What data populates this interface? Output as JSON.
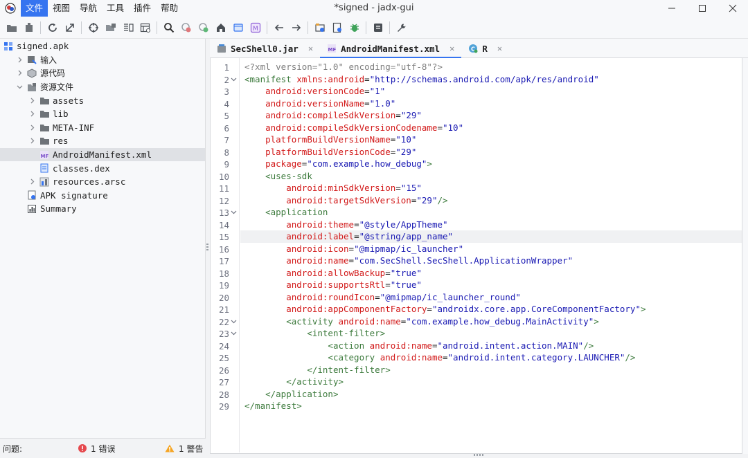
{
  "window": {
    "title": "*signed - jadx-gui",
    "menu": [
      "文件",
      "视图",
      "导航",
      "工具",
      "插件",
      "帮助"
    ]
  },
  "toolbar": {
    "icons": [
      "open-folder-icon",
      "export-icon",
      "refresh-icon",
      "goto-icon",
      "sync-icon",
      "flatten-icon",
      "text-search-icon",
      "class-search-icon",
      "search-icon",
      "find-usage-icon",
      "find-usage-alt-icon",
      "home-icon",
      "window-icon",
      "mapping-icon",
      "back-icon",
      "forward-icon",
      "deobf-icon",
      "log-icon",
      "debug-icon",
      "preferences-file-icon",
      "settings-icon"
    ]
  },
  "tree": {
    "root": "signed.apk",
    "items": [
      {
        "label": "signed.apk",
        "icon": "apk-icon",
        "level": 0,
        "arrow": ""
      },
      {
        "label": "输入",
        "icon": "input-icon",
        "level": 1,
        "arrow": ">"
      },
      {
        "label": "源代码",
        "icon": "package-icon",
        "level": 1,
        "arrow": ">"
      },
      {
        "label": "资源文件",
        "icon": "resources-icon",
        "level": 1,
        "arrow": "v"
      },
      {
        "label": "assets",
        "icon": "folder-icon",
        "level": 2,
        "arrow": ">"
      },
      {
        "label": "lib",
        "icon": "folder-icon",
        "level": 2,
        "arrow": ">"
      },
      {
        "label": "META-INF",
        "icon": "folder-icon",
        "level": 2,
        "arrow": ">"
      },
      {
        "label": "res",
        "icon": "folder-icon",
        "level": 2,
        "arrow": ">"
      },
      {
        "label": "AndroidManifest.xml",
        "icon": "manifest-icon",
        "level": 2,
        "arrow": ""
      },
      {
        "label": "classes.dex",
        "icon": "dex-icon",
        "level": 2,
        "arrow": ""
      },
      {
        "label": "resources.arsc",
        "icon": "arsc-icon",
        "level": 2,
        "arrow": ">"
      },
      {
        "label": "APK signature",
        "icon": "signature-icon",
        "level": 1,
        "arrow": ""
      },
      {
        "label": "Summary",
        "icon": "summary-icon",
        "level": 1,
        "arrow": ""
      }
    ],
    "selected_index": 8
  },
  "status": {
    "label": "问题:",
    "errors": "1 错误",
    "warnings": "1 警告"
  },
  "tabs": [
    {
      "label": "SecShell0.jar",
      "icon": "jar-icon",
      "active": false
    },
    {
      "label": "AndroidManifest.xml",
      "icon": "manifest-icon",
      "active": true
    },
    {
      "label": "R",
      "icon": "class-icon",
      "active": false
    }
  ],
  "editor": {
    "highlight_line": 15,
    "fold_lines": [
      2,
      13,
      22,
      23
    ],
    "lines": [
      [
        [
          "pi",
          "<?xml version=\"1.0\" encoding=\"utf-8\"?>"
        ]
      ],
      [
        [
          "tag",
          "<manifest "
        ],
        [
          "attr",
          "xmlns:android"
        ],
        [
          "txt",
          "="
        ],
        [
          "val",
          "\"http://schemas.android.com/apk/res/android\""
        ]
      ],
      [
        [
          "txt",
          "    "
        ],
        [
          "attr",
          "android:versionCode"
        ],
        [
          "txt",
          "="
        ],
        [
          "val",
          "\"1\""
        ]
      ],
      [
        [
          "txt",
          "    "
        ],
        [
          "attr",
          "android:versionName"
        ],
        [
          "txt",
          "="
        ],
        [
          "val",
          "\"1.0\""
        ]
      ],
      [
        [
          "txt",
          "    "
        ],
        [
          "attr",
          "android:compileSdkVersion"
        ],
        [
          "txt",
          "="
        ],
        [
          "val",
          "\"29\""
        ]
      ],
      [
        [
          "txt",
          "    "
        ],
        [
          "attr",
          "android:compileSdkVersionCodename"
        ],
        [
          "txt",
          "="
        ],
        [
          "val",
          "\"10\""
        ]
      ],
      [
        [
          "txt",
          "    "
        ],
        [
          "attr",
          "platformBuildVersionName"
        ],
        [
          "txt",
          "="
        ],
        [
          "val",
          "\"10\""
        ]
      ],
      [
        [
          "txt",
          "    "
        ],
        [
          "attr",
          "platformBuildVersionCode"
        ],
        [
          "txt",
          "="
        ],
        [
          "val",
          "\"29\""
        ]
      ],
      [
        [
          "txt",
          "    "
        ],
        [
          "attr",
          "package"
        ],
        [
          "txt",
          "="
        ],
        [
          "val",
          "\"com.example.how_debug\""
        ],
        [
          "tag",
          ">"
        ]
      ],
      [
        [
          "txt",
          "    "
        ],
        [
          "tag",
          "<uses-sdk"
        ]
      ],
      [
        [
          "txt",
          "        "
        ],
        [
          "attr",
          "android:minSdkVersion"
        ],
        [
          "txt",
          "="
        ],
        [
          "val",
          "\"15\""
        ]
      ],
      [
        [
          "txt",
          "        "
        ],
        [
          "attr",
          "android:targetSdkVersion"
        ],
        [
          "txt",
          "="
        ],
        [
          "val",
          "\"29\""
        ],
        [
          "tag",
          "/>"
        ]
      ],
      [
        [
          "txt",
          "    "
        ],
        [
          "tag",
          "<application"
        ]
      ],
      [
        [
          "txt",
          "        "
        ],
        [
          "attr",
          "android:theme"
        ],
        [
          "txt",
          "="
        ],
        [
          "val",
          "\"@style/AppTheme\""
        ]
      ],
      [
        [
          "txt",
          "        "
        ],
        [
          "attr",
          "android:label"
        ],
        [
          "txt",
          "="
        ],
        [
          "val",
          "\"@string/app_name\""
        ]
      ],
      [
        [
          "txt",
          "        "
        ],
        [
          "attr",
          "android:icon"
        ],
        [
          "txt",
          "="
        ],
        [
          "val",
          "\"@mipmap/ic_launcher\""
        ]
      ],
      [
        [
          "txt",
          "        "
        ],
        [
          "attr",
          "android:name"
        ],
        [
          "txt",
          "="
        ],
        [
          "val",
          "\"com.SecShell.SecShell.ApplicationWrapper\""
        ]
      ],
      [
        [
          "txt",
          "        "
        ],
        [
          "attr",
          "android:allowBackup"
        ],
        [
          "txt",
          "="
        ],
        [
          "val",
          "\"true\""
        ]
      ],
      [
        [
          "txt",
          "        "
        ],
        [
          "attr",
          "android:supportsRtl"
        ],
        [
          "txt",
          "="
        ],
        [
          "val",
          "\"true\""
        ]
      ],
      [
        [
          "txt",
          "        "
        ],
        [
          "attr",
          "android:roundIcon"
        ],
        [
          "txt",
          "="
        ],
        [
          "val",
          "\"@mipmap/ic_launcher_round\""
        ]
      ],
      [
        [
          "txt",
          "        "
        ],
        [
          "attr",
          "android:appComponentFactory"
        ],
        [
          "txt",
          "="
        ],
        [
          "val",
          "\"androidx.core.app.CoreComponentFactory\""
        ],
        [
          "tag",
          ">"
        ]
      ],
      [
        [
          "txt",
          "        "
        ],
        [
          "tag",
          "<activity "
        ],
        [
          "attr",
          "android:name"
        ],
        [
          "txt",
          "="
        ],
        [
          "val",
          "\"com.example.how_debug.MainActivity\""
        ],
        [
          "tag",
          ">"
        ]
      ],
      [
        [
          "txt",
          "            "
        ],
        [
          "tag",
          "<intent-filter>"
        ]
      ],
      [
        [
          "txt",
          "                "
        ],
        [
          "tag",
          "<action "
        ],
        [
          "attr",
          "android:name"
        ],
        [
          "txt",
          "="
        ],
        [
          "val",
          "\"android.intent.action.MAIN\""
        ],
        [
          "tag",
          "/>"
        ]
      ],
      [
        [
          "txt",
          "                "
        ],
        [
          "tag",
          "<category "
        ],
        [
          "attr",
          "android:name"
        ],
        [
          "txt",
          "="
        ],
        [
          "val",
          "\"android.intent.category.LAUNCHER\""
        ],
        [
          "tag",
          "/>"
        ]
      ],
      [
        [
          "txt",
          "            "
        ],
        [
          "tag",
          "</intent-filter>"
        ]
      ],
      [
        [
          "txt",
          "        "
        ],
        [
          "tag",
          "</activity>"
        ]
      ],
      [
        [
          "txt",
          "    "
        ],
        [
          "tag",
          "</application>"
        ]
      ],
      [
        [
          "tag",
          "</manifest>"
        ]
      ]
    ]
  },
  "colors": {
    "accent": "#3574f0",
    "xml_tag": "#3c7a3c",
    "xml_attr": "#d21a1a",
    "xml_value": "#1a1ab3",
    "error": "#e5484d",
    "warning": "#f5a524"
  }
}
